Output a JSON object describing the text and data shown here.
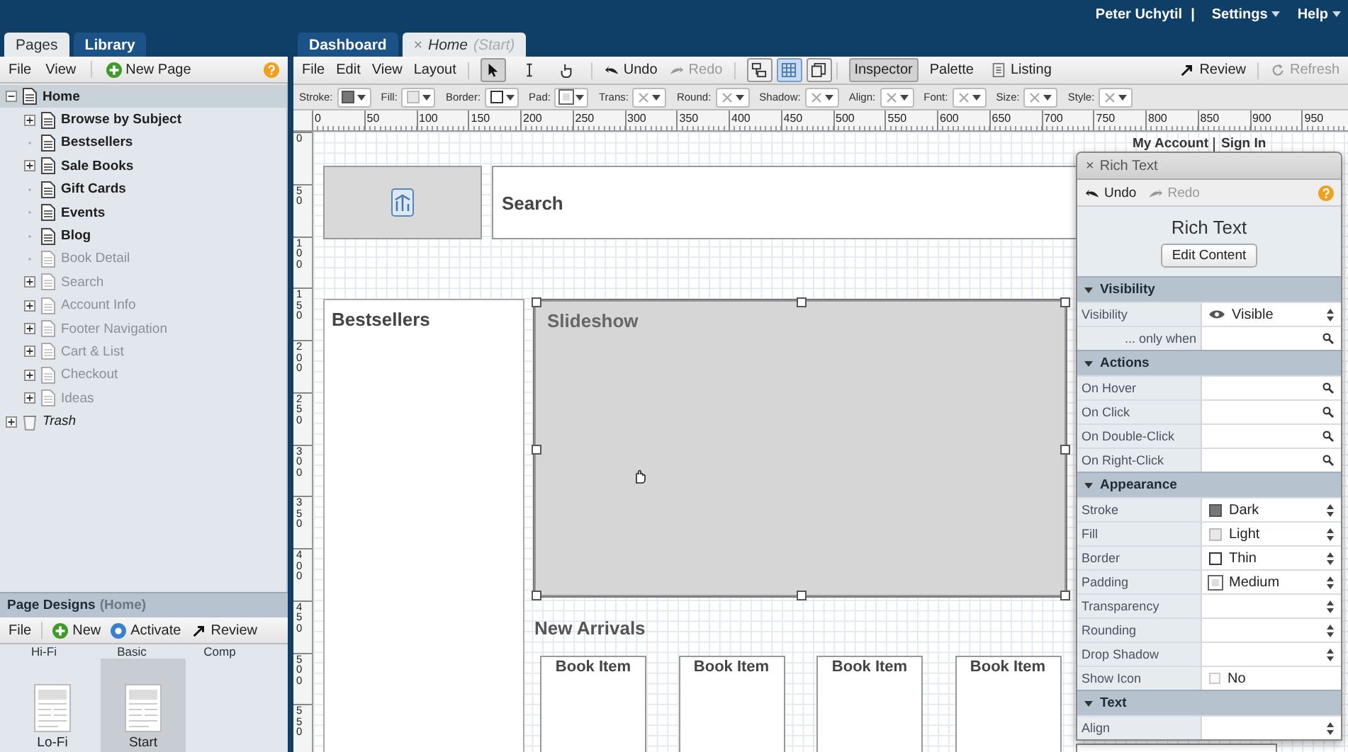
{
  "header": {
    "user": "Peter Uchytil",
    "separator": "|",
    "menus": [
      "Settings",
      "Help"
    ]
  },
  "left": {
    "tabs": [
      {
        "label": "Pages",
        "selected": true
      },
      {
        "label": "Library",
        "selected": false
      }
    ],
    "menu": [
      "File",
      "View"
    ],
    "new_button": "New Page",
    "tree": [
      {
        "label": "Home",
        "kind": "page",
        "active": true,
        "selected": true,
        "expanded": true,
        "children": [
          {
            "label": "Browse by Subject",
            "kind": "page",
            "active": true,
            "selected": false,
            "expanded": false
          },
          {
            "label": "Bestsellers",
            "kind": "page",
            "active": true,
            "selected": false
          },
          {
            "label": "Sale Books",
            "kind": "page",
            "active": true,
            "selected": false,
            "expanded": false
          },
          {
            "label": "Gift Cards",
            "kind": "page",
            "active": true,
            "selected": false
          },
          {
            "label": "Events",
            "kind": "page",
            "active": true,
            "selected": false
          },
          {
            "label": "Blog",
            "kind": "page",
            "active": true,
            "selected": false
          },
          {
            "label": "Book Detail",
            "kind": "page",
            "active": false,
            "selected": false
          },
          {
            "label": "Search",
            "kind": "page",
            "active": false,
            "selected": false,
            "expanded": false
          },
          {
            "label": "Account Info",
            "kind": "page",
            "active": false,
            "selected": false,
            "expanded": false
          },
          {
            "label": "Footer Navigation",
            "kind": "page",
            "active": false,
            "selected": false,
            "expanded": false
          },
          {
            "label": "Cart & List",
            "kind": "page",
            "active": false,
            "selected": false,
            "expanded": false
          },
          {
            "label": "Checkout",
            "kind": "page",
            "active": false,
            "selected": false,
            "expanded": false
          },
          {
            "label": "Ideas",
            "kind": "page",
            "active": false,
            "selected": false,
            "expanded": false
          }
        ]
      },
      {
        "label": "Trash",
        "kind": "trash",
        "active": true,
        "selected": false,
        "expanded": false
      }
    ],
    "designs": {
      "title": "Page Designs",
      "context": "(Home)",
      "menu": "File",
      "actions": [
        {
          "label": "New",
          "kind": "new"
        },
        {
          "label": "Activate",
          "kind": "activate"
        },
        {
          "label": "Review",
          "kind": "review"
        }
      ],
      "upper_row": [
        "Hi-Fi",
        "Basic",
        "Comp"
      ],
      "thumbs": [
        {
          "label": "Lo-Fi",
          "selected": false
        },
        {
          "label": "Start",
          "selected": true
        }
      ]
    }
  },
  "main": {
    "tabs": [
      {
        "label": "Dashboard",
        "selected": false
      },
      {
        "label": "Home",
        "design": "(Start)",
        "close": "×",
        "selected": true
      }
    ],
    "toolbar": {
      "menus": [
        "File",
        "Edit",
        "View",
        "Layout"
      ],
      "tools": [
        {
          "kind": "pointer",
          "selected": true
        },
        {
          "kind": "text",
          "selected": false
        },
        {
          "kind": "hand",
          "selected": false
        }
      ],
      "history": [
        {
          "label": "Undo",
          "disabled": false
        },
        {
          "label": "Redo",
          "disabled": true
        }
      ],
      "views": [
        {
          "kind": "outline",
          "selected": false
        },
        {
          "kind": "grid",
          "selected": true
        },
        {
          "kind": "pages",
          "selected": false
        }
      ],
      "panels": [
        {
          "label": "Inspector",
          "kind": "plain",
          "selected": true
        },
        {
          "label": "Palette",
          "kind": "plain",
          "selected": false
        },
        {
          "label": "Listing",
          "kind": "icon",
          "selected": false
        }
      ],
      "actions": [
        {
          "label": "Review",
          "kind": "review",
          "disabled": false
        },
        {
          "label": "Refresh",
          "kind": "refresh",
          "disabled": true
        }
      ]
    },
    "style_bar": [
      {
        "label": "Stroke:",
        "kind": "dark"
      },
      {
        "label": "Fill:",
        "kind": "light"
      },
      {
        "label": "Border:",
        "kind": "outline"
      },
      {
        "label": "Pad:",
        "kind": "inset"
      },
      {
        "label": "Trans:",
        "kind": "none"
      },
      {
        "label": "Round:",
        "kind": "none"
      },
      {
        "label": "Shadow:",
        "kind": "none"
      },
      {
        "label": "Align:",
        "kind": "none"
      },
      {
        "label": "Font:",
        "kind": "none"
      },
      {
        "label": "Size:",
        "kind": "none"
      },
      {
        "label": "Style:",
        "kind": "none"
      }
    ],
    "ruler": {
      "h": [
        "0",
        "50",
        "100",
        "150",
        "200",
        "250",
        "300",
        "350",
        "400",
        "450",
        "500",
        "550",
        "600",
        "650",
        "700",
        "750",
        "800",
        "850",
        "900",
        "950"
      ],
      "v": [
        "0",
        "50",
        "100",
        "150",
        "200",
        "250",
        "300",
        "350",
        "400",
        "450",
        "500",
        "550"
      ]
    },
    "canvas": {
      "search_label": "Search",
      "account_links": [
        "My Account",
        "Sign In"
      ],
      "bestsellers": "Bestsellers",
      "slideshow": {
        "label": "Slideshow",
        "selected": true
      },
      "new_arrivals": "New Arrivals",
      "book_items": [
        "Book Item",
        "Book Item",
        "Book Item",
        "Book Item"
      ]
    },
    "inspector": {
      "close": "×",
      "title": "Rich Text",
      "history": [
        {
          "label": "Undo",
          "disabled": false
        },
        {
          "label": "Redo",
          "disabled": true
        }
      ],
      "heading": "Rich Text",
      "button": "Edit Content",
      "sections": [
        {
          "title": "Visibility",
          "expanded": true,
          "rows": [
            {
              "label": "Visibility",
              "kind": "select",
              "value": "Visible",
              "swatch": {
                "kind": "eye"
              }
            },
            {
              "label": "... only when",
              "kind": "condition"
            }
          ]
        },
        {
          "title": "Actions",
          "expanded": true,
          "rows": [
            {
              "label": "On Hover",
              "kind": "search"
            },
            {
              "label": "On Click",
              "kind": "search"
            },
            {
              "label": "On Double-Click",
              "kind": "search"
            },
            {
              "label": "On Right-Click",
              "kind": "search"
            }
          ]
        },
        {
          "title": "Appearance",
          "expanded": true,
          "rows": [
            {
              "label": "Stroke",
              "kind": "select",
              "value": "Dark",
              "swatch": {
                "kind": "dark"
              }
            },
            {
              "label": "Fill",
              "kind": "select",
              "value": "Light",
              "swatch": {
                "kind": "light"
              }
            },
            {
              "label": "Border",
              "kind": "select",
              "value": "Thin",
              "swatch": {
                "kind": "outline"
              }
            },
            {
              "label": "Padding",
              "kind": "select",
              "value": "Medium",
              "swatch": {
                "kind": "inset"
              }
            },
            {
              "label": "Transparency",
              "kind": "select"
            },
            {
              "label": "Rounding",
              "kind": "select"
            },
            {
              "label": "Drop Shadow",
              "kind": "select"
            },
            {
              "label": "Show Icon",
              "kind": "checkbox",
              "value": "No",
              "checked": false
            }
          ]
        },
        {
          "title": "Text",
          "expanded": true,
          "rows": [
            {
              "label": "Align",
              "kind": "select"
            }
          ]
        }
      ]
    }
  }
}
